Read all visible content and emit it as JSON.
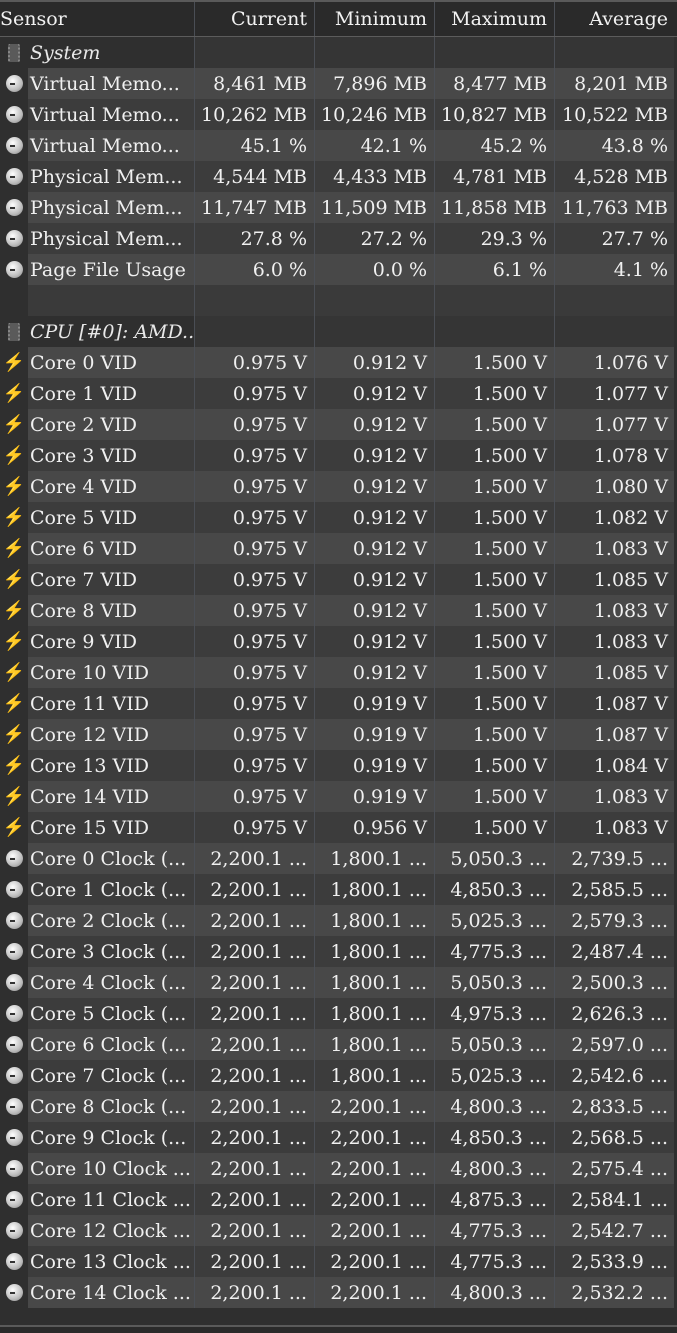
{
  "header": {
    "sensor": "Sensor",
    "current": "Current",
    "minimum": "Minimum",
    "maximum": "Maximum",
    "average": "Average"
  },
  "rows": [
    {
      "type": "group",
      "icon": "chip-icon",
      "name": "System"
    },
    {
      "type": "sensor",
      "icon": "clock-icon",
      "name": "Virtual Memo...",
      "current": "8,461 MB",
      "minimum": "7,896 MB",
      "maximum": "8,477 MB",
      "average": "8,201 MB"
    },
    {
      "type": "sensor",
      "icon": "clock-icon",
      "name": "Virtual Memo...",
      "current": "10,262 MB",
      "minimum": "10,246 MB",
      "maximum": "10,827 MB",
      "average": "10,522 MB"
    },
    {
      "type": "sensor",
      "icon": "clock-icon",
      "name": "Virtual Memo...",
      "current": "45.1 %",
      "minimum": "42.1 %",
      "maximum": "45.2 %",
      "average": "43.8 %"
    },
    {
      "type": "sensor",
      "icon": "clock-icon",
      "name": "Physical Mem...",
      "current": "4,544 MB",
      "minimum": "4,433 MB",
      "maximum": "4,781 MB",
      "average": "4,528 MB"
    },
    {
      "type": "sensor",
      "icon": "clock-icon",
      "name": "Physical Mem...",
      "current": "11,747 MB",
      "minimum": "11,509 MB",
      "maximum": "11,858 MB",
      "average": "11,763 MB"
    },
    {
      "type": "sensor",
      "icon": "clock-icon",
      "name": "Physical Mem...",
      "current": "27.8 %",
      "minimum": "27.2 %",
      "maximum": "29.3 %",
      "average": "27.7 %"
    },
    {
      "type": "sensor",
      "icon": "clock-icon",
      "name": "Page File Usage",
      "current": "6.0 %",
      "minimum": "0.0 %",
      "maximum": "6.1 %",
      "average": "4.1 %"
    },
    {
      "type": "spacer"
    },
    {
      "type": "group",
      "icon": "chip-icon",
      "name": "CPU [#0]: AMD..."
    },
    {
      "type": "sensor",
      "icon": "bolt-icon",
      "name": "Core 0 VID",
      "current": "0.975 V",
      "minimum": "0.912 V",
      "maximum": "1.500 V",
      "average": "1.076 V"
    },
    {
      "type": "sensor",
      "icon": "bolt-icon",
      "name": "Core 1 VID",
      "current": "0.975 V",
      "minimum": "0.912 V",
      "maximum": "1.500 V",
      "average": "1.077 V"
    },
    {
      "type": "sensor",
      "icon": "bolt-icon",
      "name": "Core 2 VID",
      "current": "0.975 V",
      "minimum": "0.912 V",
      "maximum": "1.500 V",
      "average": "1.077 V"
    },
    {
      "type": "sensor",
      "icon": "bolt-icon",
      "name": "Core 3 VID",
      "current": "0.975 V",
      "minimum": "0.912 V",
      "maximum": "1.500 V",
      "average": "1.078 V"
    },
    {
      "type": "sensor",
      "icon": "bolt-icon",
      "name": "Core 4 VID",
      "current": "0.975 V",
      "minimum": "0.912 V",
      "maximum": "1.500 V",
      "average": "1.080 V"
    },
    {
      "type": "sensor",
      "icon": "bolt-icon",
      "name": "Core 5 VID",
      "current": "0.975 V",
      "minimum": "0.912 V",
      "maximum": "1.500 V",
      "average": "1.082 V"
    },
    {
      "type": "sensor",
      "icon": "bolt-icon",
      "name": "Core 6 VID",
      "current": "0.975 V",
      "minimum": "0.912 V",
      "maximum": "1.500 V",
      "average": "1.083 V"
    },
    {
      "type": "sensor",
      "icon": "bolt-icon",
      "name": "Core 7 VID",
      "current": "0.975 V",
      "minimum": "0.912 V",
      "maximum": "1.500 V",
      "average": "1.085 V"
    },
    {
      "type": "sensor",
      "icon": "bolt-icon",
      "name": "Core 8 VID",
      "current": "0.975 V",
      "minimum": "0.912 V",
      "maximum": "1.500 V",
      "average": "1.083 V"
    },
    {
      "type": "sensor",
      "icon": "bolt-icon",
      "name": "Core 9 VID",
      "current": "0.975 V",
      "minimum": "0.912 V",
      "maximum": "1.500 V",
      "average": "1.083 V"
    },
    {
      "type": "sensor",
      "icon": "bolt-icon",
      "name": "Core 10 VID",
      "current": "0.975 V",
      "minimum": "0.912 V",
      "maximum": "1.500 V",
      "average": "1.085 V"
    },
    {
      "type": "sensor",
      "icon": "bolt-icon",
      "name": "Core 11 VID",
      "current": "0.975 V",
      "minimum": "0.919 V",
      "maximum": "1.500 V",
      "average": "1.087 V"
    },
    {
      "type": "sensor",
      "icon": "bolt-icon",
      "name": "Core 12 VID",
      "current": "0.975 V",
      "minimum": "0.919 V",
      "maximum": "1.500 V",
      "average": "1.087 V"
    },
    {
      "type": "sensor",
      "icon": "bolt-icon",
      "name": "Core 13 VID",
      "current": "0.975 V",
      "minimum": "0.919 V",
      "maximum": "1.500 V",
      "average": "1.084 V"
    },
    {
      "type": "sensor",
      "icon": "bolt-icon",
      "name": "Core 14 VID",
      "current": "0.975 V",
      "minimum": "0.919 V",
      "maximum": "1.500 V",
      "average": "1.083 V"
    },
    {
      "type": "sensor",
      "icon": "bolt-icon",
      "name": "Core 15 VID",
      "current": "0.975 V",
      "minimum": "0.956 V",
      "maximum": "1.500 V",
      "average": "1.083 V"
    },
    {
      "type": "sensor",
      "icon": "clock-icon",
      "name": "Core 0 Clock (...",
      "current": "2,200.1 ...",
      "minimum": "1,800.1 ...",
      "maximum": "5,050.3 ...",
      "average": "2,739.5 ..."
    },
    {
      "type": "sensor",
      "icon": "clock-icon",
      "name": "Core 1 Clock (...",
      "current": "2,200.1 ...",
      "minimum": "1,800.1 ...",
      "maximum": "4,850.3 ...",
      "average": "2,585.5 ..."
    },
    {
      "type": "sensor",
      "icon": "clock-icon",
      "name": "Core 2 Clock (...",
      "current": "2,200.1 ...",
      "minimum": "1,800.1 ...",
      "maximum": "5,025.3 ...",
      "average": "2,579.3 ..."
    },
    {
      "type": "sensor",
      "icon": "clock-icon",
      "name": "Core 3 Clock (...",
      "current": "2,200.1 ...",
      "minimum": "1,800.1 ...",
      "maximum": "4,775.3 ...",
      "average": "2,487.4 ..."
    },
    {
      "type": "sensor",
      "icon": "clock-icon",
      "name": "Core 4 Clock (...",
      "current": "2,200.1 ...",
      "minimum": "1,800.1 ...",
      "maximum": "5,050.3 ...",
      "average": "2,500.3 ..."
    },
    {
      "type": "sensor",
      "icon": "clock-icon",
      "name": "Core 5 Clock (...",
      "current": "2,200.1 ...",
      "minimum": "1,800.1 ...",
      "maximum": "4,975.3 ...",
      "average": "2,626.3 ..."
    },
    {
      "type": "sensor",
      "icon": "clock-icon",
      "name": "Core 6 Clock (...",
      "current": "2,200.1 ...",
      "minimum": "1,800.1 ...",
      "maximum": "5,050.3 ...",
      "average": "2,597.0 ..."
    },
    {
      "type": "sensor",
      "icon": "clock-icon",
      "name": "Core 7 Clock (...",
      "current": "2,200.1 ...",
      "minimum": "1,800.1 ...",
      "maximum": "5,025.3 ...",
      "average": "2,542.6 ..."
    },
    {
      "type": "sensor",
      "icon": "clock-icon",
      "name": "Core 8 Clock (...",
      "current": "2,200.1 ...",
      "minimum": "2,200.1 ...",
      "maximum": "4,800.3 ...",
      "average": "2,833.5 ..."
    },
    {
      "type": "sensor",
      "icon": "clock-icon",
      "name": "Core 9 Clock (...",
      "current": "2,200.1 ...",
      "minimum": "2,200.1 ...",
      "maximum": "4,850.3 ...",
      "average": "2,568.5 ..."
    },
    {
      "type": "sensor",
      "icon": "clock-icon",
      "name": "Core 10 Clock ...",
      "current": "2,200.1 ...",
      "minimum": "2,200.1 ...",
      "maximum": "4,800.3 ...",
      "average": "2,575.4 ..."
    },
    {
      "type": "sensor",
      "icon": "clock-icon",
      "name": "Core 11 Clock ...",
      "current": "2,200.1 ...",
      "minimum": "2,200.1 ...",
      "maximum": "4,875.3 ...",
      "average": "2,584.1 ..."
    },
    {
      "type": "sensor",
      "icon": "clock-icon",
      "name": "Core 12 Clock ...",
      "current": "2,200.1 ...",
      "minimum": "2,200.1 ...",
      "maximum": "4,775.3 ...",
      "average": "2,542.7 ..."
    },
    {
      "type": "sensor",
      "icon": "clock-icon",
      "name": "Core 13 Clock ...",
      "current": "2,200.1 ...",
      "minimum": "2,200.1 ...",
      "maximum": "4,775.3 ...",
      "average": "2,533.9 ..."
    },
    {
      "type": "sensor",
      "icon": "clock-icon",
      "name": "Core 14 Clock ...",
      "current": "2,200.1 ...",
      "minimum": "2,200.1 ...",
      "maximum": "4,800.3 ...",
      "average": "2,532.2 ..."
    }
  ]
}
